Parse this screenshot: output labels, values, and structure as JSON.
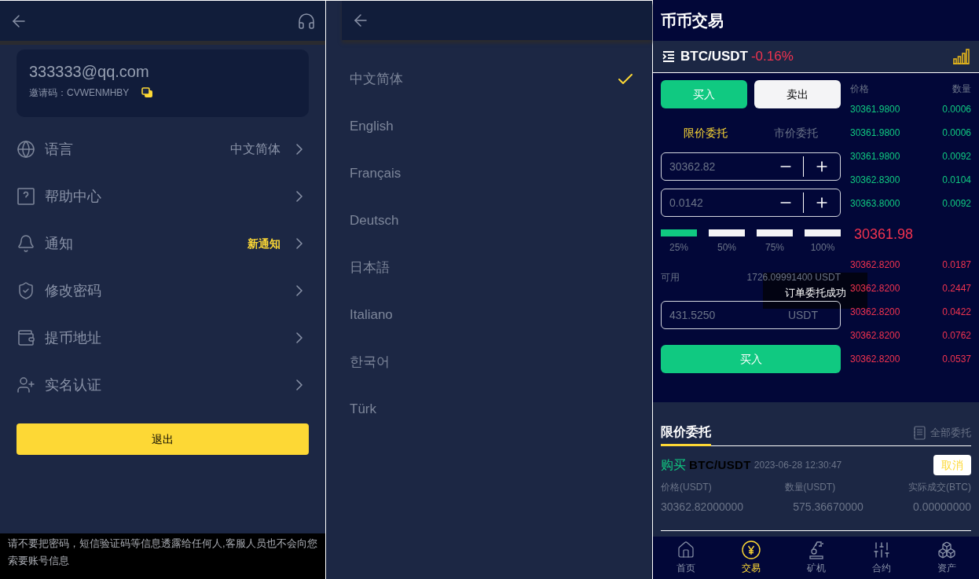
{
  "account_panel": {
    "email": "333333@qq.com",
    "invite_label": "邀请码：",
    "invite_code": "CVWENMHBY",
    "menu": [
      {
        "kind": "value",
        "label": "语言",
        "value": "中文简体"
      },
      {
        "label": "帮助中心"
      },
      {
        "kind": "alert",
        "label": "通知",
        "value": "新通知"
      },
      {
        "label": "修改密码"
      },
      {
        "label": "提币地址"
      },
      {
        "label": "实名认证"
      }
    ],
    "logout": "退出",
    "notice": "请不要把密码，短信验证码等信息透露给任何人,客服人员也不会向您索要账号信息"
  },
  "language_panel": {
    "languages": [
      {
        "label": "中文简体",
        "selected": true
      },
      {
        "label": "English",
        "selected": false
      },
      {
        "label": "Français",
        "selected": false
      },
      {
        "label": "Deutsch",
        "selected": false
      },
      {
        "label": "日本語",
        "selected": false
      },
      {
        "label": "Italiano",
        "selected": false
      },
      {
        "label": "한국어",
        "selected": false
      },
      {
        "label": "Türk",
        "selected": false
      }
    ]
  },
  "trade_panel": {
    "title": "币币交易",
    "pair": "BTC/USDT",
    "change": "-0.16%",
    "side_tabs": [
      {
        "label": "买入",
        "selected": true
      },
      {
        "label": "卖出",
        "selected": false
      }
    ],
    "order_types": [
      {
        "label": "限价委托",
        "selected": true
      },
      {
        "label": "市价委托",
        "selected": false
      }
    ],
    "price_input": {
      "value": "30362.82"
    },
    "quantity_input": {
      "value": "0.0142"
    },
    "percent_buttons": [
      {
        "label": "25%",
        "selected": true
      },
      {
        "label": "50%",
        "selected": false
      },
      {
        "label": "75%",
        "selected": false
      },
      {
        "label": "100%",
        "selected": false
      }
    ],
    "available_label": "可用",
    "available_value": "1726.09991400 USDT",
    "amount_input": {
      "value": "431.5250",
      "unit": "USDT"
    },
    "submit": "买入",
    "toast": "订单委托成功",
    "order_book": {
      "columns": [
        "价格",
        "数量"
      ],
      "upper_rows": [
        {
          "price": "30361.9800",
          "quantity": "0.0006"
        },
        {
          "price": "30361.9800",
          "quantity": "0.0006"
        },
        {
          "price": "30361.9800",
          "quantity": "0.0092"
        },
        {
          "price": "30362.8300",
          "quantity": "0.0104"
        },
        {
          "price": "30363.8000",
          "quantity": "0.0092"
        }
      ],
      "last_price": "30361.98",
      "lower_rows": [
        {
          "price": "30362.8200",
          "quantity": "0.0187"
        },
        {
          "price": "30362.8200",
          "quantity": "0.2447"
        },
        {
          "price": "30362.8200",
          "quantity": "0.0422"
        },
        {
          "price": "30362.8200",
          "quantity": "0.0762"
        },
        {
          "price": "30362.8200",
          "quantity": "0.0537"
        }
      ]
    },
    "orders": {
      "tab": {
        "label": "限价委托",
        "selected": true
      },
      "all_link": "全部委托",
      "items": [
        {
          "side": "购买",
          "pair": "BTC/USDT",
          "time": "2023-06-28 12:30:47",
          "cancel": "取消",
          "columns": [
            {
              "label": "价格(USDT)",
              "value": "30362.82000000"
            },
            {
              "label": "数量(USDT)",
              "value": "575.36670000"
            },
            {
              "label": "实际成交(BTC)",
              "value": "0.00000000"
            }
          ]
        }
      ]
    },
    "nav": [
      {
        "label": "首页",
        "selected": false
      },
      {
        "label": "交易",
        "selected": true
      },
      {
        "label": "矿机",
        "selected": false
      },
      {
        "label": "合约",
        "selected": false
      },
      {
        "label": "资产",
        "selected": false
      }
    ]
  }
}
